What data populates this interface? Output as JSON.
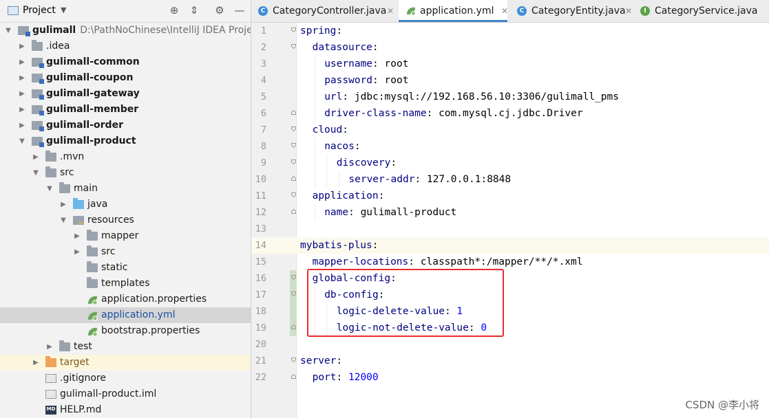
{
  "project_panel": {
    "title": "Project",
    "tree": [
      {
        "label": "gulimall",
        "path": "D:\\PathNoChinese\\IntelliJ IDEA Project",
        "bold": true,
        "depth": 0,
        "arrow": "down",
        "icon": "module-icon"
      },
      {
        "label": ".idea",
        "depth": 1,
        "arrow": "right",
        "icon": "folder-icon"
      },
      {
        "label": "gulimall-common",
        "bold": true,
        "depth": 1,
        "arrow": "right",
        "icon": "module-icon"
      },
      {
        "label": "gulimall-coupon",
        "bold": true,
        "depth": 1,
        "arrow": "right",
        "icon": "module-icon"
      },
      {
        "label": "gulimall-gateway",
        "bold": true,
        "depth": 1,
        "arrow": "right",
        "icon": "module-icon"
      },
      {
        "label": "gulimall-member",
        "bold": true,
        "depth": 1,
        "arrow": "right",
        "icon": "module-icon"
      },
      {
        "label": "gulimall-order",
        "bold": true,
        "depth": 1,
        "arrow": "right",
        "icon": "module-icon"
      },
      {
        "label": "gulimall-product",
        "bold": true,
        "depth": 1,
        "arrow": "down",
        "icon": "module-icon"
      },
      {
        "label": ".mvn",
        "depth": 2,
        "arrow": "right",
        "icon": "folder-icon"
      },
      {
        "label": "src",
        "depth": 2,
        "arrow": "down",
        "icon": "folder-icon"
      },
      {
        "label": "main",
        "depth": 3,
        "arrow": "down",
        "icon": "folder-icon"
      },
      {
        "label": "java",
        "depth": 4,
        "arrow": "right",
        "icon": "java-folder-icon"
      },
      {
        "label": "resources",
        "depth": 4,
        "arrow": "down",
        "icon": "resources-folder-icon"
      },
      {
        "label": "mapper",
        "depth": 5,
        "arrow": "right",
        "icon": "folder-icon"
      },
      {
        "label": "src",
        "depth": 5,
        "arrow": "right",
        "icon": "folder-icon"
      },
      {
        "label": "static",
        "depth": 5,
        "arrow": "",
        "icon": "folder-icon"
      },
      {
        "label": "templates",
        "depth": 5,
        "arrow": "",
        "icon": "folder-icon"
      },
      {
        "label": "application.properties",
        "depth": 5,
        "arrow": "",
        "icon": "spring-leaf-icon"
      },
      {
        "label": "application.yml",
        "depth": 5,
        "arrow": "",
        "icon": "spring-leaf-icon",
        "selected": true,
        "color": "#1a4fa0"
      },
      {
        "label": "bootstrap.properties",
        "depth": 5,
        "arrow": "",
        "icon": "spring-leaf-icon"
      },
      {
        "label": "test",
        "depth": 3,
        "arrow": "right",
        "icon": "folder-icon"
      },
      {
        "label": "target",
        "depth": 2,
        "arrow": "right",
        "icon": "excluded-folder-icon",
        "excluded": true,
        "color": "#7a5c1a"
      },
      {
        "label": ".gitignore",
        "depth": 2,
        "arrow": "",
        "icon": "file-icon"
      },
      {
        "label": "gulimall-product.iml",
        "depth": 2,
        "arrow": "",
        "icon": "file-icon"
      },
      {
        "label": "HELP.md",
        "depth": 2,
        "arrow": "",
        "icon": "markdown-icon",
        "md_text": "MD"
      }
    ]
  },
  "tabs": [
    {
      "label": "CategoryController.java",
      "icon": "class-icon",
      "icon_text": "C",
      "icon_color": "#3b8ed6",
      "active": false,
      "closable": true
    },
    {
      "label": "application.yml",
      "icon": "spring-leaf-icon",
      "icon_text": "",
      "icon_color": "#6ba75a",
      "active": true,
      "closable": true
    },
    {
      "label": "CategoryEntity.java",
      "icon": "class-icon",
      "icon_text": "C",
      "icon_color": "#3b8ed6",
      "active": false,
      "closable": true
    },
    {
      "label": "CategoryService.java",
      "icon": "interface-icon",
      "icon_text": "I",
      "icon_color": "#5ca14a",
      "active": false,
      "closable": false
    }
  ],
  "editor": {
    "lines": [
      {
        "n": "1",
        "indent": 0,
        "key": "spring",
        "sep": ":",
        "value": "",
        "fold": "open"
      },
      {
        "n": "2",
        "indent": 1,
        "key": "datasource",
        "sep": ":",
        "value": "",
        "fold": "open"
      },
      {
        "n": "3",
        "indent": 2,
        "key": "username",
        "sep": ": ",
        "value": "root",
        "fold": ""
      },
      {
        "n": "4",
        "indent": 2,
        "key": "password",
        "sep": ": ",
        "value": "root",
        "fold": ""
      },
      {
        "n": "5",
        "indent": 2,
        "key": "url",
        "sep": ": ",
        "value": "jdbc:mysql://192.168.56.10:3306/gulimall_pms",
        "fold": ""
      },
      {
        "n": "6",
        "indent": 2,
        "key": "driver-class-name",
        "sep": ": ",
        "value": "com.mysql.cj.jdbc.Driver",
        "fold": "close"
      },
      {
        "n": "7",
        "indent": 1,
        "key": "cloud",
        "sep": ":",
        "value": "",
        "fold": "open"
      },
      {
        "n": "8",
        "indent": 2,
        "key": "nacos",
        "sep": ":",
        "value": "",
        "fold": "open"
      },
      {
        "n": "9",
        "indent": 3,
        "key": "discovery",
        "sep": ":",
        "value": "",
        "fold": "open"
      },
      {
        "n": "10",
        "indent": 4,
        "key": "server-addr",
        "sep": ": ",
        "value": "127.0.0.1:8848",
        "fold": "close"
      },
      {
        "n": "11",
        "indent": 1,
        "key": "application",
        "sep": ":",
        "value": "",
        "fold": "open"
      },
      {
        "n": "12",
        "indent": 2,
        "key": "name",
        "sep": ": ",
        "value": "gulimall-product",
        "fold": "close"
      },
      {
        "n": "13",
        "indent": 0,
        "key": "",
        "sep": "",
        "value": "",
        "fold": ""
      },
      {
        "n": "14",
        "indent": 0,
        "key": "mybatis-plus",
        "sep": ":",
        "value": "",
        "fold": "",
        "caret": true
      },
      {
        "n": "15",
        "indent": 1,
        "key": "mapper-locations",
        "sep": ": ",
        "value": "classpath*:/mapper/**/*.xml",
        "fold": ""
      },
      {
        "n": "16",
        "indent": 1,
        "key": "global-config",
        "sep": ":",
        "value": "",
        "fold": "open",
        "changed": true
      },
      {
        "n": "17",
        "indent": 2,
        "key": "db-config",
        "sep": ":",
        "value": "",
        "fold": "open",
        "changed": true
      },
      {
        "n": "18",
        "indent": 3,
        "key": "logic-delete-value",
        "sep": ": ",
        "value": "1",
        "value_type": "number",
        "fold": "",
        "changed": true
      },
      {
        "n": "19",
        "indent": 3,
        "key": "logic-not-delete-value",
        "sep": ": ",
        "value": "0",
        "value_type": "number",
        "fold": "close",
        "changed": true
      },
      {
        "n": "20",
        "indent": 0,
        "key": "",
        "sep": "",
        "value": "",
        "fold": ""
      },
      {
        "n": "21",
        "indent": 0,
        "key": "server",
        "sep": ":",
        "value": "",
        "fold": "open"
      },
      {
        "n": "22",
        "indent": 1,
        "key": "port",
        "sep": ": ",
        "value": "12000",
        "value_type": "number",
        "fold": "close"
      }
    ]
  },
  "watermark": "CSDN @李小将",
  "colors": {
    "key": "#000080",
    "number": "#0000ff",
    "highlight_box": "#ea2b2b",
    "active_tab_underline": "#4083c9"
  }
}
